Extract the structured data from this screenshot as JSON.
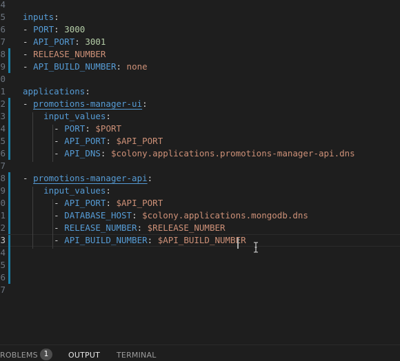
{
  "editor": {
    "lines": [
      {
        "num": "4",
        "parts": []
      },
      {
        "num": "5",
        "parts": [
          {
            "t": "inputs",
            "c": "k"
          },
          {
            "t": ":",
            "c": "p"
          }
        ]
      },
      {
        "num": "6",
        "parts": [
          {
            "t": "- ",
            "c": "p"
          },
          {
            "t": "PORT",
            "c": "k"
          },
          {
            "t": ": ",
            "c": "p"
          },
          {
            "t": "3000",
            "c": "n"
          }
        ]
      },
      {
        "num": "7",
        "parts": [
          {
            "t": "- ",
            "c": "p"
          },
          {
            "t": "API_PORT",
            "c": "k"
          },
          {
            "t": ": ",
            "c": "p"
          },
          {
            "t": "3001",
            "c": "n"
          }
        ]
      },
      {
        "num": "8",
        "git": true,
        "parts": [
          {
            "t": "- ",
            "c": "p"
          },
          {
            "t": "RELEASE_NUMBER",
            "c": "v"
          }
        ]
      },
      {
        "num": "9",
        "git": true,
        "parts": [
          {
            "t": "- ",
            "c": "p"
          },
          {
            "t": "API_BUILD_NUMBER",
            "c": "k"
          },
          {
            "t": ": ",
            "c": "p"
          },
          {
            "t": "none",
            "c": "v"
          }
        ]
      },
      {
        "num": "0",
        "parts": []
      },
      {
        "num": "1",
        "parts": [
          {
            "t": "applications",
            "c": "k"
          },
          {
            "t": ":",
            "c": "p"
          }
        ]
      },
      {
        "num": "2",
        "git": true,
        "parts": [
          {
            "t": "- ",
            "c": "p"
          },
          {
            "t": "promotions-manager-ui",
            "c": "k anchor"
          },
          {
            "t": ":",
            "c": "p"
          }
        ]
      },
      {
        "num": "3",
        "git": true,
        "parts": [
          {
            "t": "    ",
            "c": "p"
          },
          {
            "t": "input_values",
            "c": "k"
          },
          {
            "t": ":",
            "c": "p"
          }
        ]
      },
      {
        "num": "4",
        "git": true,
        "parts": [
          {
            "t": "      - ",
            "c": "p"
          },
          {
            "t": "PORT",
            "c": "k"
          },
          {
            "t": ": ",
            "c": "p"
          },
          {
            "t": "$PORT",
            "c": "v"
          }
        ]
      },
      {
        "num": "5",
        "git": true,
        "parts": [
          {
            "t": "      - ",
            "c": "p"
          },
          {
            "t": "API_PORT",
            "c": "k"
          },
          {
            "t": ": ",
            "c": "p"
          },
          {
            "t": "$API_PORT",
            "c": "v"
          }
        ]
      },
      {
        "num": "6",
        "git": true,
        "parts": [
          {
            "t": "      - ",
            "c": "p"
          },
          {
            "t": "API_DNS",
            "c": "k"
          },
          {
            "t": ": ",
            "c": "p"
          },
          {
            "t": "$colony.applications.promotions-manager-api.dns",
            "c": "v"
          }
        ]
      },
      {
        "num": "7",
        "parts": []
      },
      {
        "num": "8",
        "git": true,
        "parts": [
          {
            "t": "- ",
            "c": "p"
          },
          {
            "t": "promotions-manager-api",
            "c": "k anchor"
          },
          {
            "t": ":",
            "c": "p"
          }
        ]
      },
      {
        "num": "9",
        "git": true,
        "parts": [
          {
            "t": "    ",
            "c": "p"
          },
          {
            "t": "input_values",
            "c": "k"
          },
          {
            "t": ":",
            "c": "p"
          }
        ]
      },
      {
        "num": "0",
        "git": true,
        "parts": [
          {
            "t": "      - ",
            "c": "p"
          },
          {
            "t": "API_PORT",
            "c": "k"
          },
          {
            "t": ": ",
            "c": "p"
          },
          {
            "t": "$API_PORT",
            "c": "v"
          }
        ]
      },
      {
        "num": "1",
        "git": true,
        "parts": [
          {
            "t": "      - ",
            "c": "p"
          },
          {
            "t": "DATABASE_HOST",
            "c": "k"
          },
          {
            "t": ": ",
            "c": "p"
          },
          {
            "t": "$colony.applications.mongodb.dns",
            "c": "v"
          }
        ]
      },
      {
        "num": "2",
        "git": true,
        "parts": [
          {
            "t": "      - ",
            "c": "p"
          },
          {
            "t": "RELEASE_NUMBER",
            "c": "k"
          },
          {
            "t": ": ",
            "c": "p"
          },
          {
            "t": "$RELEASE_NUMBER",
            "c": "v"
          }
        ]
      },
      {
        "num": "3",
        "git": true,
        "current": true,
        "parts": [
          {
            "t": "      - ",
            "c": "p"
          },
          {
            "t": "API_BUILD_NUMBER",
            "c": "k"
          },
          {
            "t": ": ",
            "c": "p"
          },
          {
            "t": "$API_BUILD_NUMBER",
            "c": "v"
          }
        ]
      },
      {
        "num": "4",
        "git": true,
        "parts": []
      },
      {
        "num": "5",
        "git": true,
        "parts": []
      },
      {
        "num": "6",
        "git": true,
        "parts": []
      },
      {
        "num": "7",
        "parts": []
      }
    ]
  },
  "panel": {
    "problems_label": "ROBLEMS",
    "problems_count": "1",
    "output_label": "OUTPUT",
    "terminal_label": "TERMINAL"
  },
  "colors": {
    "background": "#1e1e1e",
    "key": "#569cd6",
    "string": "#ce9178",
    "number": "#b5cea8",
    "git_modified": "#1b81a8"
  }
}
